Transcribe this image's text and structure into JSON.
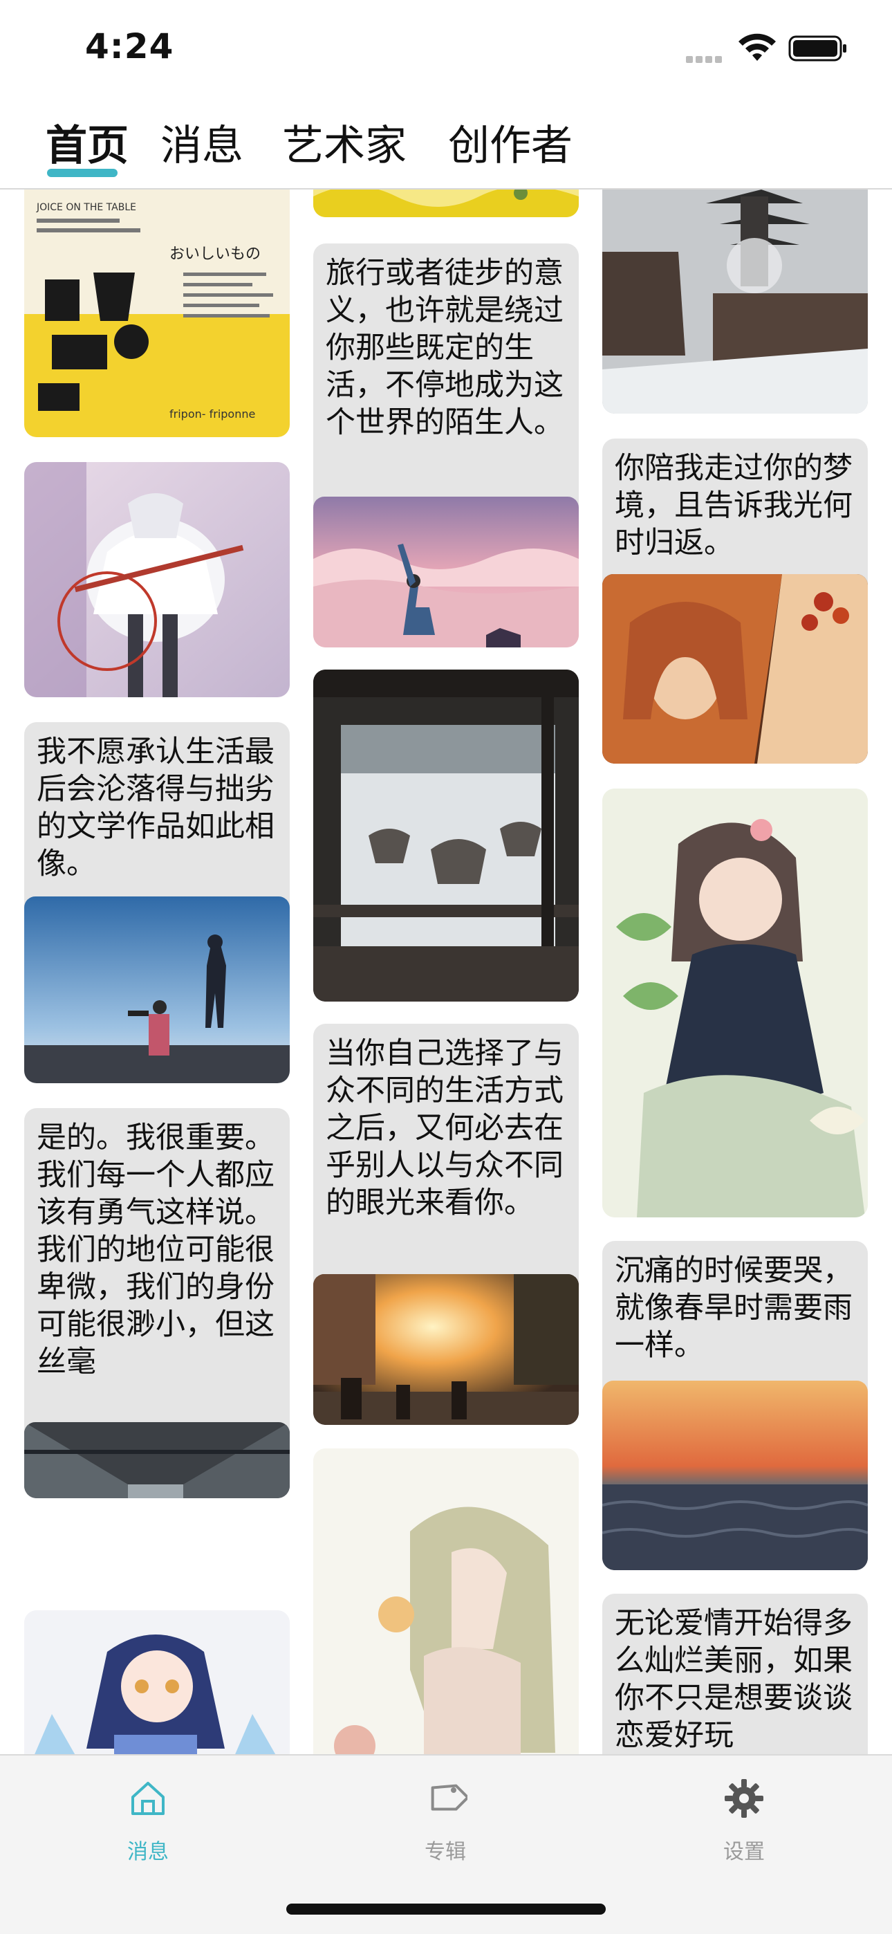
{
  "status_bar": {
    "time": "4:24"
  },
  "top_tabs": [
    {
      "label": "首页",
      "active": true
    },
    {
      "label": "消息",
      "active": false
    },
    {
      "label": "艺术家",
      "active": false
    },
    {
      "label": "创作者",
      "active": false
    }
  ],
  "accent_color": "#3fb6c6",
  "feed": {
    "cards": [
      {
        "text": ""
      },
      {
        "text": ""
      },
      {
        "text": "我不愿承认生活最后会沦落得与拙劣的文学作品如此相像。"
      },
      {
        "text": "是的。我很重要。我们每一个人都应该有勇气这样说。我们的地位可能很卑微，我们的身份可能很渺小，但这丝毫"
      },
      {
        "text": ""
      },
      {
        "text": ""
      },
      {
        "text": "旅行或者徒步的意义，也许就是绕过你那些既定的生活，不停地成为这个世界的陌生人。"
      },
      {
        "text": ""
      },
      {
        "text": "当你自己选择了与众不同的生活方式之后，又何必去在乎别人以与众不同的眼光来看你。"
      },
      {
        "text": ""
      },
      {
        "text": ""
      },
      {
        "text": "你陪我走过你的梦境，且告诉我光何时归返。"
      },
      {
        "text": ""
      },
      {
        "text": "沉痛的时候要哭，就像春旱时需要雨一样。"
      },
      {
        "text": "无论爱情开始得多么灿烂美丽，如果你不只是想要谈谈恋爱好玩"
      }
    ],
    "images": {
      "poster": {
        "title": "おいしいもの",
        "brand": "fripon- friponne",
        "subtitle": "JOICE ON THE TABLE"
      }
    }
  },
  "bottom_tabs": [
    {
      "label": "消息",
      "icon": "home-icon",
      "active": true
    },
    {
      "label": "专辑",
      "icon": "tag-icon",
      "active": false
    },
    {
      "label": "设置",
      "icon": "gear-icon",
      "active": false
    }
  ]
}
